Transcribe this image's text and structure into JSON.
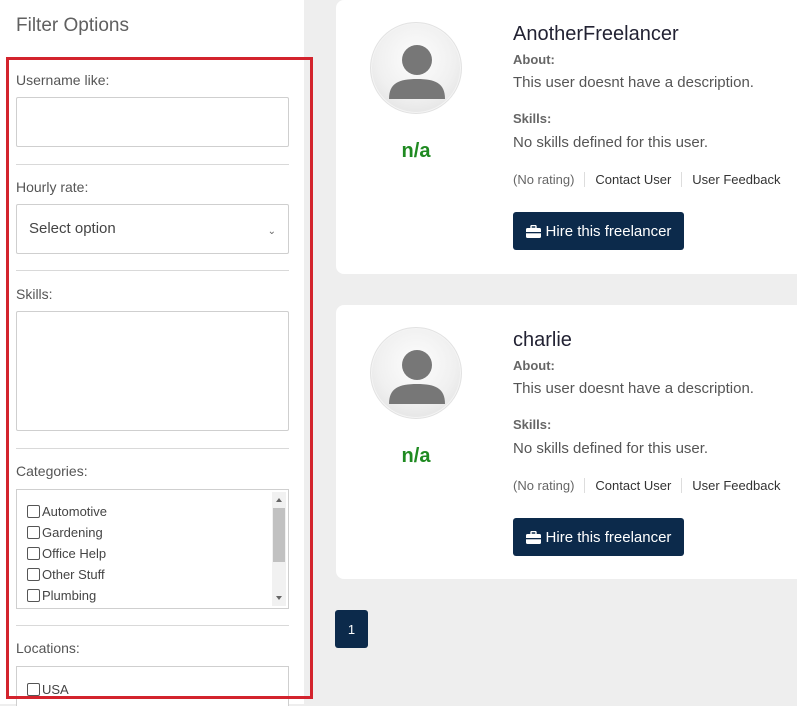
{
  "filter": {
    "title": "Filter Options",
    "username_label": "Username like:",
    "username_value": "",
    "hourly_label": "Hourly rate:",
    "hourly_selected": "Select option",
    "skills_label": "Skills:",
    "categories_label": "Categories:",
    "categories": [
      "Automotive",
      "Gardening",
      "Office Help",
      "Other Stuff",
      "Plumbing"
    ],
    "locations_label": "Locations:",
    "locations": [
      "USA"
    ]
  },
  "freelancers": [
    {
      "username": "AnotherFreelancer",
      "rating": "n/a",
      "about_label": "About:",
      "about_text": "This user doesnt have a description.",
      "skills_label": "Skills:",
      "skills_text": "No skills defined for this user.",
      "rating_text": "(No rating)",
      "contact_label": "Contact User",
      "feedback_label": "User Feedback",
      "hire_label": "Hire this freelancer"
    },
    {
      "username": "charlie",
      "rating": "n/a",
      "about_label": "About:",
      "about_text": "This user doesnt have a description.",
      "skills_label": "Skills:",
      "skills_text": "No skills defined for this user.",
      "rating_text": "(No rating)",
      "contact_label": "Contact User",
      "feedback_label": "User Feedback",
      "hire_label": "Hire this freelancer"
    }
  ],
  "pagination": {
    "current": "1"
  },
  "icons": {
    "avatar": "default-user-icon",
    "hire": "briefcase-icon",
    "select": "chevron-down-icon"
  },
  "colors": {
    "primary": "#0c2a4b",
    "rating": "#1f8a21",
    "highlight": "#d3232d"
  }
}
